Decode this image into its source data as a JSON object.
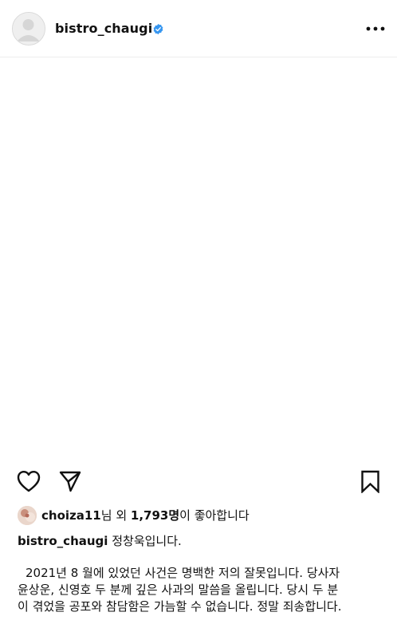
{
  "header": {
    "username": "bistro_chaugi",
    "verified": true,
    "more_icon": "more-horizontal-icon"
  },
  "actions": {
    "like_icon": "heart-icon",
    "share_icon": "send-icon",
    "save_icon": "bookmark-icon"
  },
  "likes": {
    "liker": "choiza11",
    "mid": "님 외 ",
    "count": "1,793명",
    "suffix": "이 좋아합니다"
  },
  "caption": {
    "username": "bistro_chaugi",
    "intro": "정창욱입니다.",
    "lines": [
      "2021년 8 월에 있었던 사건은 명백한 저의 잘못입니다. 당사자",
      "윤상운, 신영호 두 분께 깊은 사과의 말씀을 올립니다. 당시 두 분",
      "이 겪었을 공포와 참담함은 가늠할 수 없습니다. 정말 죄송합니다."
    ]
  },
  "colors": {
    "verified_badge": "#3897f0",
    "divider": "#ededed",
    "icon": "#111111"
  }
}
